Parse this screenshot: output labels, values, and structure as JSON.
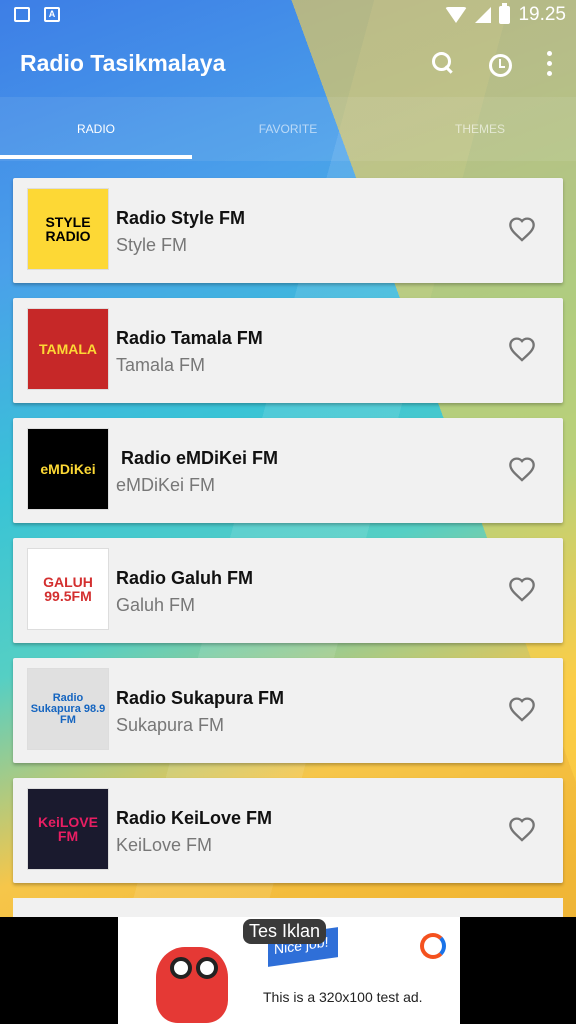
{
  "status_bar": {
    "time": "19.25"
  },
  "app_bar": {
    "title": "Radio Tasikmalaya"
  },
  "tabs": [
    {
      "label": "RADIO"
    },
    {
      "label": "FAVORITE"
    },
    {
      "label": "THEMES"
    }
  ],
  "stations": [
    {
      "title": "Radio Style FM",
      "subtitle": "Style FM",
      "logo_text": "STYLE RADIO",
      "logo_bg": "#fdd835",
      "logo_fg": "#000000"
    },
    {
      "title": "Radio Tamala FM",
      "subtitle": "Tamala FM",
      "logo_text": "TAMALA",
      "logo_bg": "#c62828",
      "logo_fg": "#fdd835"
    },
    {
      "title": " Radio eMDiKei FM",
      "subtitle": "eMDiKei FM",
      "logo_text": "eMDiKei",
      "logo_bg": "#000000",
      "logo_fg": "#fdd835"
    },
    {
      "title": "Radio Galuh FM",
      "subtitle": "Galuh FM",
      "logo_text": "GALUH 99.5FM",
      "logo_bg": "#ffffff",
      "logo_fg": "#d32f2f"
    },
    {
      "title": "Radio Sukapura FM",
      "subtitle": "Sukapura FM",
      "logo_text": "Radio Sukapura 98.9 FM",
      "logo_bg": "#e0e0e0",
      "logo_fg": "#1565c0"
    },
    {
      "title": "Radio KeiLove FM",
      "subtitle": "KeiLove FM",
      "logo_text": "KeiLOVE FM",
      "logo_bg": "#1a1a2e",
      "logo_fg": "#e91e63"
    }
  ],
  "ad": {
    "tag": "Tes Iklan",
    "flag_text": "Nice job!",
    "text": "This is a 320x100 test ad."
  },
  "colors": {
    "card_bg": "#f1f1f1",
    "heart": "#757575"
  }
}
